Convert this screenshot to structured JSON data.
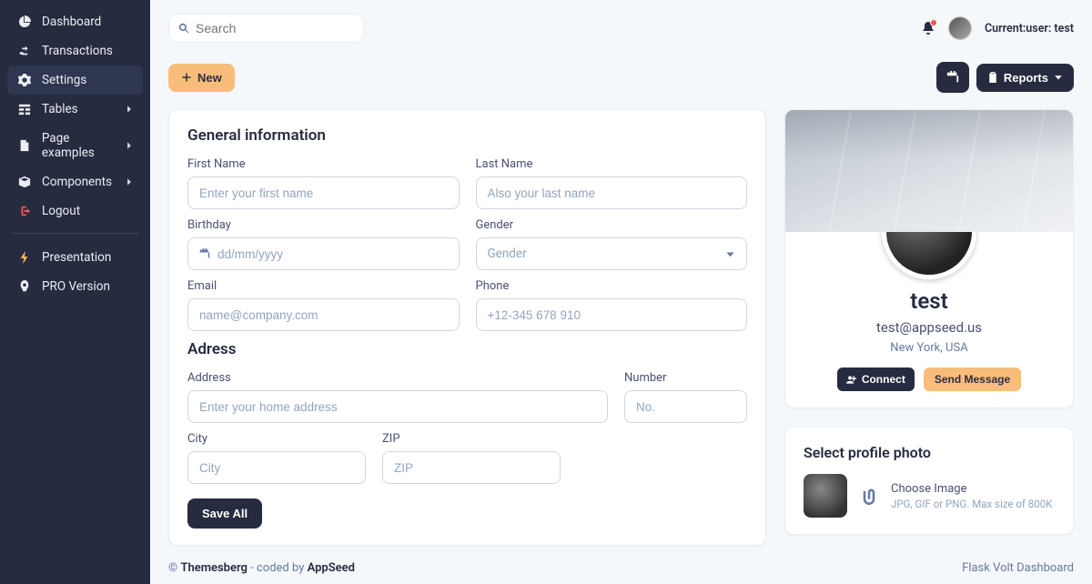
{
  "sidebar": {
    "items": [
      {
        "label": "Dashboard"
      },
      {
        "label": "Transactions"
      },
      {
        "label": "Settings"
      },
      {
        "label": "Tables"
      },
      {
        "label": "Page examples"
      },
      {
        "label": "Components"
      },
      {
        "label": "Logout"
      }
    ],
    "secondary": [
      {
        "label": "Presentation"
      },
      {
        "label": "PRO Version"
      }
    ]
  },
  "search": {
    "placeholder": "Search"
  },
  "user": {
    "label": "Current:user: test"
  },
  "actions": {
    "new_label": "New",
    "reports_label": "Reports"
  },
  "general": {
    "heading": "General information",
    "first_name_label": "First Name",
    "first_name_ph": "Enter your first name",
    "last_name_label": "Last Name",
    "last_name_ph": "Also your last name",
    "birthday_label": "Birthday",
    "birthday_ph": "dd/mm/yyyy",
    "gender_label": "Gender",
    "gender_value": "Gender",
    "email_label": "Email",
    "email_ph": "name@company.com",
    "phone_label": "Phone",
    "phone_ph": "+12-345 678 910"
  },
  "address": {
    "heading": "Adress",
    "address_label": "Address",
    "address_ph": "Enter your home address",
    "number_label": "Number",
    "number_ph": "No.",
    "city_label": "City",
    "city_ph": "City",
    "zip_label": "ZIP",
    "zip_ph": "ZIP",
    "save_label": "Save All"
  },
  "profile": {
    "name": "test",
    "email": "test@appseed.us",
    "location": "New York, USA",
    "connect_label": "Connect",
    "message_label": "Send Message"
  },
  "photo": {
    "heading": "Select profile photo",
    "choose_label": "Choose Image",
    "hint": "JPG, GIF or PNG. Max size of 800K"
  },
  "footer": {
    "left_a": "© ",
    "left_b": "Themesberg",
    "left_c": " - coded by ",
    "left_d": "AppSeed",
    "right": "Flask Volt Dashboard"
  }
}
